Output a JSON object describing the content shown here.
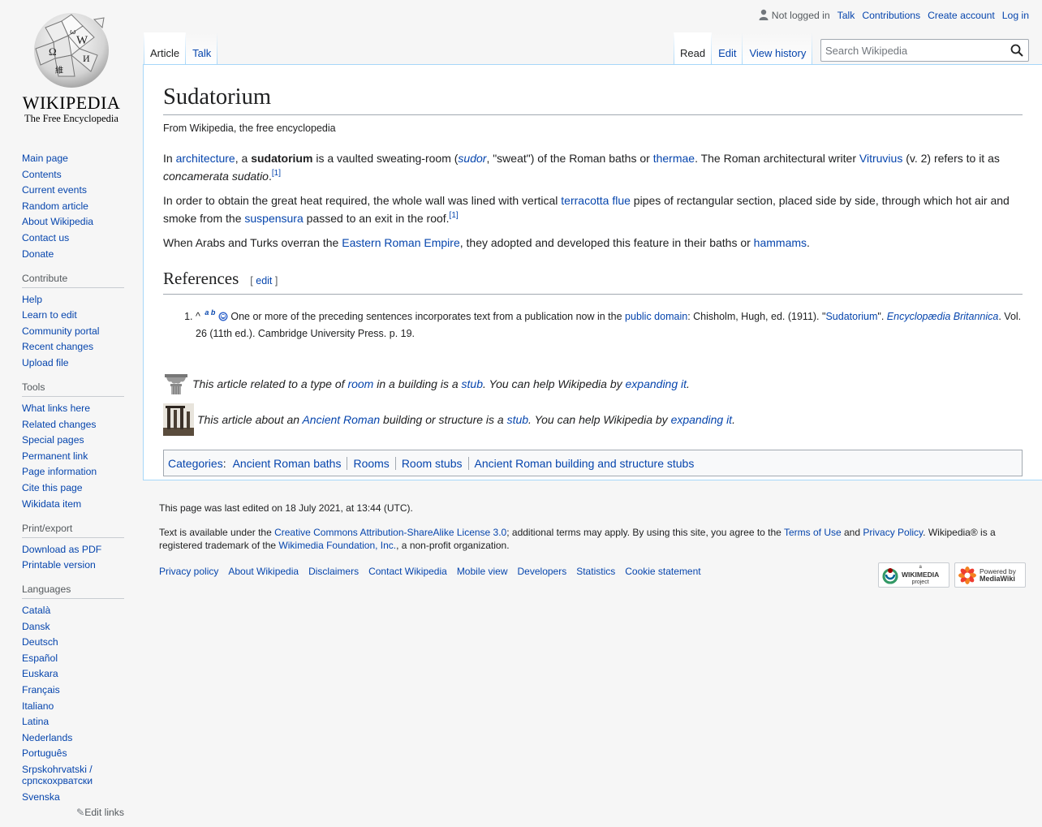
{
  "logo": {
    "wordmark": "Wikipedia",
    "wordmark_display": "WIKIPEDIA",
    "tagline": "The Free Encyclopedia"
  },
  "personal": {
    "not_logged_in": "Not logged in",
    "talk": "Talk",
    "contributions": "Contributions",
    "create_account": "Create account",
    "log_in": "Log in"
  },
  "tabs": {
    "article": "Article",
    "talk": "Talk",
    "read": "Read",
    "edit": "Edit",
    "view_history": "View history"
  },
  "search": {
    "placeholder": "Search Wikipedia"
  },
  "sidebar": {
    "navigation": [
      "Main page",
      "Contents",
      "Current events",
      "Random article",
      "About Wikipedia",
      "Contact us",
      "Donate"
    ],
    "contribute": {
      "heading": "Contribute",
      "items": [
        "Help",
        "Learn to edit",
        "Community portal",
        "Recent changes",
        "Upload file"
      ]
    },
    "tools": {
      "heading": "Tools",
      "items": [
        "What links here",
        "Related changes",
        "Special pages",
        "Permanent link",
        "Page information",
        "Cite this page",
        "Wikidata item"
      ]
    },
    "print": {
      "heading": "Print/export",
      "items": [
        "Download as PDF",
        "Printable version"
      ]
    },
    "languages": {
      "heading": "Languages",
      "items": [
        "Català",
        "Dansk",
        "Deutsch",
        "Español",
        "Euskara",
        "Français",
        "Italiano",
        "Latina",
        "Nederlands",
        "Português",
        "Srpskohrvatski / српскохрватски",
        "Svenska"
      ],
      "edit_links": "Edit links"
    }
  },
  "article": {
    "title": "Sudatorium",
    "site_sub": "From Wikipedia, the free encyclopedia",
    "p1": {
      "t1": "In ",
      "l_architecture": "architecture",
      "t2": ", a ",
      "b_sudatorium": "sudatorium",
      "t3": " is a vaulted sweating-room (",
      "l_sudor": "sudor",
      "t4": ", \"sweat\") of the Roman baths or ",
      "l_thermae": "thermae",
      "t5": ". The Roman architectural writer ",
      "l_vitruvius": "Vitruvius",
      "t6": " (v. 2) refers to it as ",
      "i_concamerata": "concamerata sudatio",
      "t7": ".",
      "ref": "[1]"
    },
    "p2": {
      "t1": "In order to obtain the great heat required, the whole wall was lined with vertical ",
      "l_terracotta": "terracotta",
      "t2": " ",
      "l_flue": "flue",
      "t3": " pipes of rectangular section, placed side by side, through which hot air and smoke from the ",
      "l_suspensura": "suspensura",
      "t4": " passed to an exit in the roof.",
      "ref": "[1]"
    },
    "p3": {
      "t1": "When Arabs and Turks overran the ",
      "l_eastern": "Eastern Roman Empire",
      "t2": ", they adopted and developed this feature in their baths or ",
      "l_hammams": "hammams",
      "t3": "."
    },
    "references": {
      "heading": "References",
      "edit_open": "[",
      "edit": "edit",
      "edit_close": "]",
      "item": {
        "caret": "^",
        "a": "a",
        "b": "b",
        "t1": " One or more of the preceding sentences incorporates text from a publication now in the ",
        "l_public_domain": "public domain",
        "t2": ": Chisholm, Hugh, ed. (1911). \"",
        "l_sudatorium": "Sudatorium",
        "t3": "\". ",
        "l_encyclopaedia": "Encyclopædia Britannica",
        "t4": ". Vol. 26 (11th ed.). Cambridge University Press. p. 19."
      }
    },
    "stub1": {
      "t1": "This article related to a type of ",
      "l_room": "room",
      "t2": " in a building is a ",
      "l_stub": "stub",
      "t3": ". You can help Wikipedia by ",
      "l_expanding": "expanding it",
      "t4": "."
    },
    "stub2": {
      "t1": "This article about an ",
      "l_ancient_roman": "Ancient Roman",
      "t2": " building or structure is a ",
      "l_stub": "stub",
      "t3": ". You can help Wikipedia by ",
      "l_expanding": "expanding it",
      "t4": "."
    },
    "categories": {
      "label": "Categories",
      "colon": ":",
      "items": [
        "Ancient Roman baths",
        "Rooms",
        "Room stubs",
        "Ancient Roman building and structure stubs"
      ]
    }
  },
  "footer": {
    "lastmod": "This page was last edited on 18 July 2021, at 13:44 (UTC).",
    "license": {
      "t1": "Text is available under the ",
      "l_license": "Creative Commons Attribution-ShareAlike License 3.0",
      "t2": "; additional terms may apply. By using this site, you agree to the ",
      "l_terms": "Terms of Use",
      "t3": " and ",
      "l_privacy": "Privacy Policy",
      "t4": ". Wikipedia® is a registered trademark of the ",
      "l_foundation": "Wikimedia Foundation, Inc.",
      "t5": ", a non-profit organization."
    },
    "places": [
      "Privacy policy",
      "About Wikipedia",
      "Disclaimers",
      "Contact Wikipedia",
      "Mobile view",
      "Developers",
      "Statistics",
      "Cookie statement"
    ],
    "badges": {
      "wikimedia_small": "a",
      "wikimedia": "WIKIMEDIA",
      "wikimedia_sub": "project",
      "powered": "Powered by",
      "mediawiki": "MediaWiki"
    }
  },
  "colors": {
    "link": "#0645ad",
    "text": "#202122",
    "border": "#a2a9b1",
    "tab_border": "#a7d7f9",
    "background": "#f6f6f6"
  },
  "icons": {
    "user": "user-icon",
    "search": "search-icon",
    "pencil": "pencil-icon",
    "globe": "wikipedia-globe-logo"
  }
}
